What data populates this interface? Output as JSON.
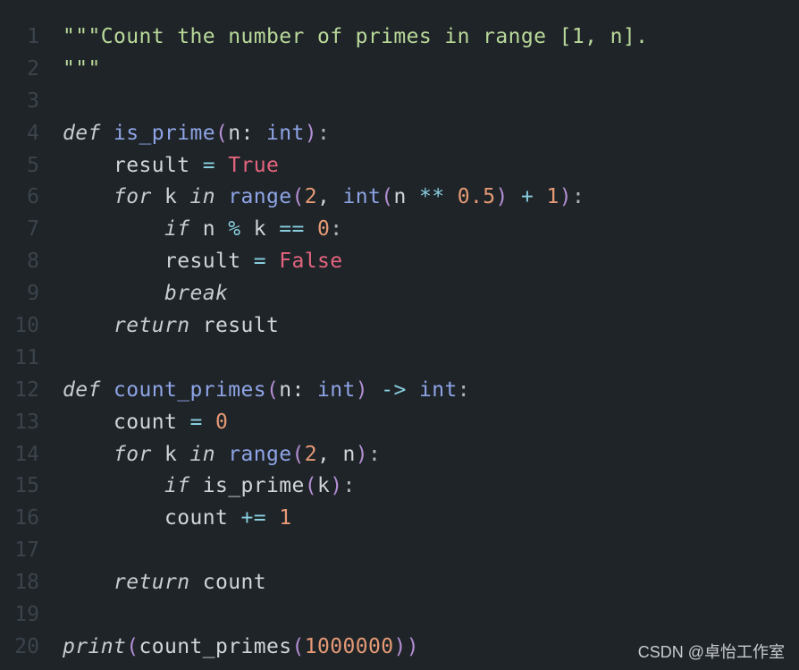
{
  "theme": {
    "background": "#1f2428",
    "line_number": "#3b444c",
    "string": "#b9d99a",
    "keyword": "#c7ccd1",
    "function": "#8ea4e6",
    "boolean": "#e4647e",
    "number": "#e59a76",
    "operator": "#89cfe0",
    "punctuation": "#b48ed4",
    "plain": "#d1d5d9"
  },
  "lines": [
    {
      "n": "1",
      "tokens": [
        {
          "t": "\"\"\"Count the number of primes in range [1, n].",
          "c": "str"
        }
      ]
    },
    {
      "n": "2",
      "tokens": [
        {
          "t": "\"\"\"",
          "c": "str"
        }
      ]
    },
    {
      "n": "3",
      "tokens": []
    },
    {
      "n": "4",
      "tokens": [
        {
          "t": "def",
          "c": "kw"
        },
        {
          "t": " ",
          "c": "plain"
        },
        {
          "t": "is_prime",
          "c": "fn"
        },
        {
          "t": "(",
          "c": "punc"
        },
        {
          "t": "n: ",
          "c": "plain"
        },
        {
          "t": "int",
          "c": "type"
        },
        {
          "t": ")",
          "c": "punc"
        },
        {
          "t": ":",
          "c": "colon"
        }
      ]
    },
    {
      "n": "5",
      "tokens": [
        {
          "t": "    result ",
          "c": "plain"
        },
        {
          "t": "=",
          "c": "op"
        },
        {
          "t": " ",
          "c": "plain"
        },
        {
          "t": "True",
          "c": "bool"
        }
      ]
    },
    {
      "n": "6",
      "tokens": [
        {
          "t": "    ",
          "c": "plain"
        },
        {
          "t": "for",
          "c": "kw"
        },
        {
          "t": " k ",
          "c": "plain"
        },
        {
          "t": "in",
          "c": "kw"
        },
        {
          "t": " ",
          "c": "plain"
        },
        {
          "t": "range",
          "c": "fn"
        },
        {
          "t": "(",
          "c": "punc"
        },
        {
          "t": "2",
          "c": "num"
        },
        {
          "t": ", ",
          "c": "plain"
        },
        {
          "t": "int",
          "c": "type"
        },
        {
          "t": "(",
          "c": "punc"
        },
        {
          "t": "n ",
          "c": "plain"
        },
        {
          "t": "**",
          "c": "op"
        },
        {
          "t": " ",
          "c": "plain"
        },
        {
          "t": "0.5",
          "c": "num"
        },
        {
          "t": ")",
          "c": "punc"
        },
        {
          "t": " ",
          "c": "plain"
        },
        {
          "t": "+",
          "c": "op"
        },
        {
          "t": " ",
          "c": "plain"
        },
        {
          "t": "1",
          "c": "num"
        },
        {
          "t": ")",
          "c": "punc"
        },
        {
          "t": ":",
          "c": "colon"
        }
      ]
    },
    {
      "n": "7",
      "tokens": [
        {
          "t": "        ",
          "c": "plain"
        },
        {
          "t": "if",
          "c": "kw"
        },
        {
          "t": " n ",
          "c": "plain"
        },
        {
          "t": "%",
          "c": "op"
        },
        {
          "t": " k ",
          "c": "plain"
        },
        {
          "t": "==",
          "c": "op"
        },
        {
          "t": " ",
          "c": "plain"
        },
        {
          "t": "0",
          "c": "num"
        },
        {
          "t": ":",
          "c": "colon"
        }
      ]
    },
    {
      "n": "8",
      "tokens": [
        {
          "t": "        result ",
          "c": "plain"
        },
        {
          "t": "=",
          "c": "op"
        },
        {
          "t": " ",
          "c": "plain"
        },
        {
          "t": "False",
          "c": "bool"
        }
      ]
    },
    {
      "n": "9",
      "tokens": [
        {
          "t": "        ",
          "c": "plain"
        },
        {
          "t": "break",
          "c": "kw"
        }
      ]
    },
    {
      "n": "10",
      "tokens": [
        {
          "t": "    ",
          "c": "plain"
        },
        {
          "t": "return",
          "c": "kw"
        },
        {
          "t": " result",
          "c": "plain"
        }
      ]
    },
    {
      "n": "11",
      "tokens": []
    },
    {
      "n": "12",
      "tokens": [
        {
          "t": "def",
          "c": "kw"
        },
        {
          "t": " ",
          "c": "plain"
        },
        {
          "t": "count_primes",
          "c": "fn"
        },
        {
          "t": "(",
          "c": "punc"
        },
        {
          "t": "n: ",
          "c": "plain"
        },
        {
          "t": "int",
          "c": "type"
        },
        {
          "t": ")",
          "c": "punc"
        },
        {
          "t": " ",
          "c": "plain"
        },
        {
          "t": "->",
          "c": "op"
        },
        {
          "t": " ",
          "c": "plain"
        },
        {
          "t": "int",
          "c": "type"
        },
        {
          "t": ":",
          "c": "colon"
        }
      ]
    },
    {
      "n": "13",
      "tokens": [
        {
          "t": "    count ",
          "c": "plain"
        },
        {
          "t": "=",
          "c": "op"
        },
        {
          "t": " ",
          "c": "plain"
        },
        {
          "t": "0",
          "c": "num"
        }
      ]
    },
    {
      "n": "14",
      "tokens": [
        {
          "t": "    ",
          "c": "plain"
        },
        {
          "t": "for",
          "c": "kw"
        },
        {
          "t": " k ",
          "c": "plain"
        },
        {
          "t": "in",
          "c": "kw"
        },
        {
          "t": " ",
          "c": "plain"
        },
        {
          "t": "range",
          "c": "fn"
        },
        {
          "t": "(",
          "c": "punc"
        },
        {
          "t": "2",
          "c": "num"
        },
        {
          "t": ", n",
          "c": "plain"
        },
        {
          "t": ")",
          "c": "punc"
        },
        {
          "t": ":",
          "c": "colon"
        }
      ]
    },
    {
      "n": "15",
      "tokens": [
        {
          "t": "        ",
          "c": "plain"
        },
        {
          "t": "if",
          "c": "kw"
        },
        {
          "t": " is_prime",
          "c": "plain"
        },
        {
          "t": "(",
          "c": "punc"
        },
        {
          "t": "k",
          "c": "plain"
        },
        {
          "t": ")",
          "c": "punc"
        },
        {
          "t": ":",
          "c": "colon"
        }
      ]
    },
    {
      "n": "16",
      "tokens": [
        {
          "t": "        count ",
          "c": "plain"
        },
        {
          "t": "+=",
          "c": "op"
        },
        {
          "t": " ",
          "c": "plain"
        },
        {
          "t": "1",
          "c": "num"
        }
      ]
    },
    {
      "n": "17",
      "tokens": []
    },
    {
      "n": "18",
      "tokens": [
        {
          "t": "    ",
          "c": "plain"
        },
        {
          "t": "return",
          "c": "kw"
        },
        {
          "t": " count",
          "c": "plain"
        }
      ]
    },
    {
      "n": "19",
      "tokens": []
    },
    {
      "n": "20",
      "tokens": [
        {
          "t": "print",
          "c": "kw"
        },
        {
          "t": "(",
          "c": "punc"
        },
        {
          "t": "count_primes",
          "c": "plain"
        },
        {
          "t": "(",
          "c": "punc"
        },
        {
          "t": "1000000",
          "c": "num"
        },
        {
          "t": ")",
          "c": "punc"
        },
        {
          "t": ")",
          "c": "punc"
        }
      ]
    }
  ],
  "watermark": "CSDN @卓怡工作室"
}
